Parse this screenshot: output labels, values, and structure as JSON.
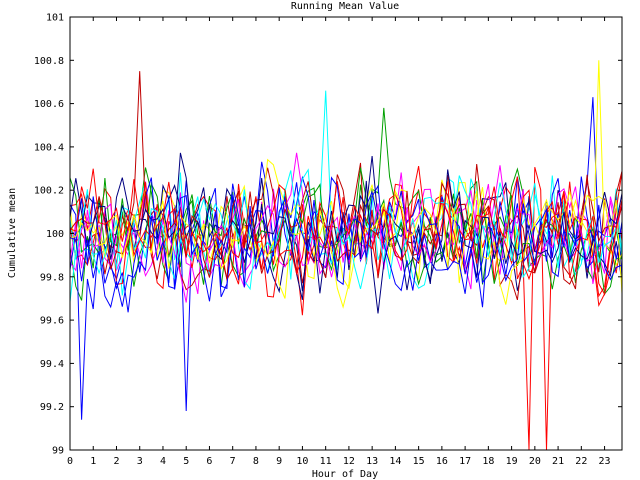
{
  "chart_data": {
    "type": "line",
    "title": "Running Mean Value",
    "xlabel": "Hour of Day",
    "ylabel": "Cumulative mean",
    "xlim": [
      0,
      23.75
    ],
    "ylim": [
      99,
      101
    ],
    "x_ticks": [
      0,
      1,
      2,
      3,
      4,
      5,
      6,
      7,
      8,
      9,
      10,
      11,
      12,
      13,
      14,
      15,
      16,
      17,
      18,
      19,
      20,
      21,
      22,
      23
    ],
    "x_tick_labels": [
      "0",
      "1",
      "2",
      "3",
      "4",
      "5",
      "6",
      "7",
      "8",
      "9",
      "10",
      "11",
      "12",
      "13",
      "14",
      "15",
      "16",
      "17",
      "18",
      "19",
      "20",
      "21",
      "22",
      "23"
    ],
    "y_ticks": [
      99,
      99.2,
      99.4,
      99.6,
      99.8,
      100,
      100.2,
      100.4,
      100.6,
      100.8,
      101
    ],
    "y_tick_labels": [
      "99",
      "99.2",
      "99.4",
      "99.6",
      "99.8",
      "100",
      "100.2",
      "100.4",
      "100.6",
      "100.8",
      "101"
    ],
    "grid": false,
    "legend": "none",
    "series_count": 18,
    "series_colors": [
      "#ff0000",
      "#00a000",
      "#0000ff",
      "#ff00ff",
      "#00ffff",
      "#c00000",
      "#ffff00",
      "#000080",
      "#ff0000",
      "#00a000",
      "#0000ff",
      "#ff00ff",
      "#00ffff",
      "#c00000",
      "#ffff00",
      "#000080",
      "#ff0000",
      "#0000ff"
    ],
    "points_per_series": 96,
    "value_mean": 100.0,
    "value_spread": 0.16,
    "peaks": [
      {
        "series": 5,
        "x": 3.0,
        "y": 100.75
      },
      {
        "series": 6,
        "x": 22.8,
        "y": 100.8
      },
      {
        "series": 4,
        "x": 10.9,
        "y": 100.66
      },
      {
        "series": 2,
        "x": 22.5,
        "y": 100.63
      },
      {
        "series": 1,
        "x": 13.4,
        "y": 100.58
      },
      {
        "series": 2,
        "x": 0.5,
        "y": 99.14
      },
      {
        "series": 2,
        "x": 5.0,
        "y": 99.18
      }
    ],
    "drops": [
      {
        "series": 0,
        "x": 19.75,
        "y": 99
      },
      {
        "series": 0,
        "x": 20.5,
        "y": 99
      }
    ]
  }
}
